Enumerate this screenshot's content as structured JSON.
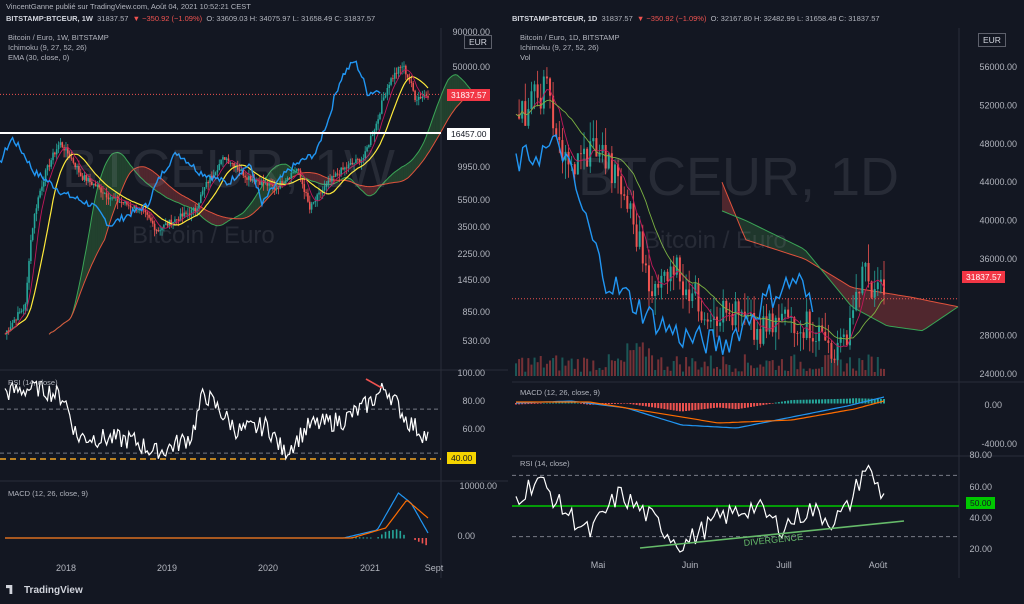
{
  "header": {
    "author_line": "VincentGanne publié sur TradingView.com, Août 04, 2021 10:52:21 CEST",
    "left": {
      "symbol": "BITSTAMP:BTCEUR, 1W",
      "last": "31837.57",
      "change": "▼ −350.92 (−1.09%)",
      "ohlc": "O: 33609.03  H: 34075.97  L: 31658.49  C: 31837.57"
    },
    "right": {
      "symbol": "BITSTAMP:BTCEUR, 1D",
      "last": "31837.57",
      "change": "▼ −350.92 (−1.09%)",
      "ohlc": "O: 32167.80  H: 32482.99  L: 31658.49  C: 31837.57"
    }
  },
  "left_chart": {
    "legend": [
      "Bitcoin / Euro, 1W, BITSTAMP",
      "Ichimoku (9, 27, 52, 26)",
      "EMA (30, close, 0)"
    ],
    "watermark": "BTCEUR, 1W",
    "watermark_sub": "Bitcoin / Euro",
    "currency": "EUR",
    "price_axis": [
      "90000.00",
      "50000.00",
      "16457.00",
      "9950.00",
      "5500.00",
      "3500.00",
      "2250.00",
      "1450.00",
      "850.00",
      "530.00"
    ],
    "price_tag": "31837.57",
    "level_tag": "16457.00",
    "rsi": {
      "legend": "RSI (14, close)",
      "axis": [
        "100.00",
        "80.00",
        "60.00",
        "40.00"
      ],
      "tag": "40.00"
    },
    "macd": {
      "legend": "MACD (12, 26, close, 9)",
      "axis": [
        "10000.00",
        "0.00"
      ]
    },
    "time_axis": [
      "2018",
      "2019",
      "2020",
      "2021",
      "Sept"
    ],
    "chart_data": {
      "type": "line",
      "x_ticks": [
        "2018",
        "2019",
        "2020",
        "2021",
        "Sept"
      ],
      "y_scale": "log",
      "ylim": [
        400,
        90000
      ],
      "horizontal_level": 16457.0,
      "last_price": 31837.57,
      "close_approx": [
        {
          "x": "2017-11",
          "y": 9000
        },
        {
          "x": "2017-12",
          "y": 14000
        },
        {
          "x": "2018-02",
          "y": 8000
        },
        {
          "x": "2018-06",
          "y": 5500
        },
        {
          "x": "2018-11",
          "y": 4500
        },
        {
          "x": "2018-12",
          "y": 3200
        },
        {
          "x": "2019-04",
          "y": 4500
        },
        {
          "x": "2019-06",
          "y": 11000
        },
        {
          "x": "2019-09",
          "y": 8000
        },
        {
          "x": "2019-12",
          "y": 6500
        },
        {
          "x": "2020-02",
          "y": 9000
        },
        {
          "x": "2020-03",
          "y": 4500
        },
        {
          "x": "2020-06",
          "y": 8500
        },
        {
          "x": "2020-10",
          "y": 11000
        },
        {
          "x": "2020-12",
          "y": 20000
        },
        {
          "x": "2021-02",
          "y": 40000
        },
        {
          "x": "2021-04",
          "y": 52000
        },
        {
          "x": "2021-06",
          "y": 30000
        },
        {
          "x": "2021-08",
          "y": 31837.57
        }
      ]
    }
  },
  "right_chart": {
    "legend": [
      "Bitcoin / Euro, 1D, BITSTAMP",
      "Ichimoku (9, 27, 52, 26)",
      "Vol"
    ],
    "watermark": "BTCEUR, 1D",
    "watermark_sub": "Bitcoin / Euro",
    "currency": "EUR",
    "price_axis": [
      "56000.00",
      "52000.00",
      "48000.00",
      "44000.00",
      "40000.00",
      "36000.00",
      "28000.00",
      "24000.00"
    ],
    "price_tag": "31837.57",
    "macd": {
      "legend": "MACD (12, 26, close, 9)",
      "axis": [
        "0.00",
        "-4000.00"
      ]
    },
    "rsi": {
      "legend": "RSI (14, close)",
      "axis": [
        "80.00",
        "60.00",
        "40.00",
        "20.00"
      ],
      "tag": "50.00",
      "annotation": "DIVERGENCE"
    },
    "time_axis": [
      "Mai",
      "Juin",
      "Juill",
      "Août"
    ],
    "chart_data": {
      "type": "line",
      "x_ticks": [
        "Mai",
        "Juin",
        "Juill",
        "Août"
      ],
      "ylim": [
        22000,
        58000
      ],
      "last_price": 31837.57,
      "close_approx": [
        {
          "x": "Avr-13",
          "y": 52000
        },
        {
          "x": "Avr-25",
          "y": 42000
        },
        {
          "x": "Mai-10",
          "y": 47000
        },
        {
          "x": "Mai-19",
          "y": 34000
        },
        {
          "x": "Mai-31",
          "y": 30000
        },
        {
          "x": "Juin-15",
          "y": 32000
        },
        {
          "x": "Juin-22",
          "y": 27500
        },
        {
          "x": "Juill-05",
          "y": 29000
        },
        {
          "x": "Juill-20",
          "y": 25500
        },
        {
          "x": "Juill-30",
          "y": 34500
        },
        {
          "x": "Août-04",
          "y": 31837.57
        }
      ]
    }
  },
  "branding": "TradingView",
  "colors": {
    "bg": "#131722",
    "up": "#26a69a",
    "down": "#ef5350",
    "rsi": "#ffffff",
    "macd": "#2196f3",
    "signal": "#ff6d00",
    "ema": "#ffeb3b",
    "lagging": "#4caf50",
    "tag_red": "#f23645",
    "tag_yellow": "#f5d400",
    "tag_green": "#00c800"
  }
}
